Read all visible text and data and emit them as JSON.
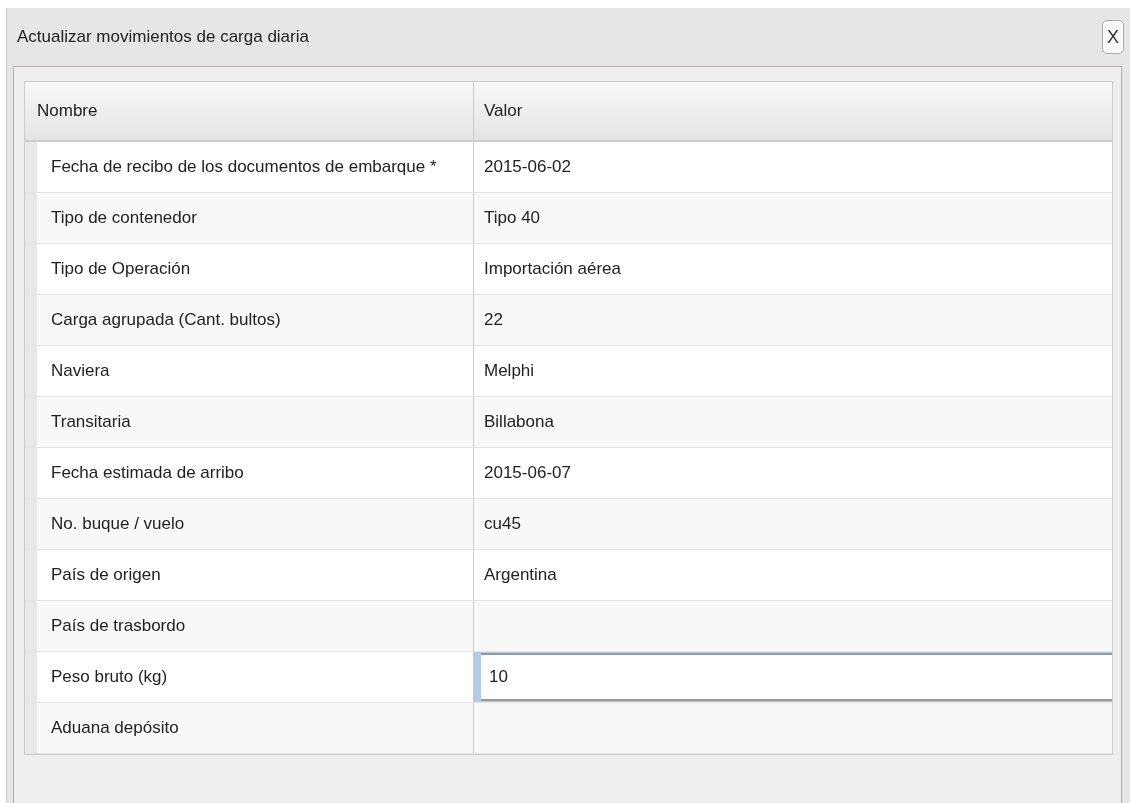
{
  "dialog": {
    "title": "Actualizar movimientos de carga diaria",
    "close_label": "X"
  },
  "table": {
    "columns": [
      "Nombre",
      "Valor"
    ],
    "rows": [
      {
        "name": "Fecha de recibo de los documentos de embarque *",
        "value": "2015-06-02",
        "editing": false
      },
      {
        "name": "Tipo de contenedor",
        "value": "Tipo 40",
        "editing": false
      },
      {
        "name": "Tipo de Operación",
        "value": "Importación aérea",
        "editing": false
      },
      {
        "name": "Carga agrupada (Cant. bultos)",
        "value": "22",
        "editing": false
      },
      {
        "name": "Naviera",
        "value": "Melphi",
        "editing": false
      },
      {
        "name": "Transitaria",
        "value": "Billabona",
        "editing": false
      },
      {
        "name": "Fecha estimada de arribo",
        "value": "2015-06-07",
        "editing": false
      },
      {
        "name": "No. buque / vuelo",
        "value": "cu45",
        "editing": false
      },
      {
        "name": "País de origen",
        "value": "Argentina",
        "editing": false
      },
      {
        "name": "País de trasbordo",
        "editing": false
      },
      {
        "name": "Peso bruto (kg)",
        "value": "10",
        "editing": true
      },
      {
        "name": "Aduana depósito",
        "editing": false
      }
    ]
  }
}
